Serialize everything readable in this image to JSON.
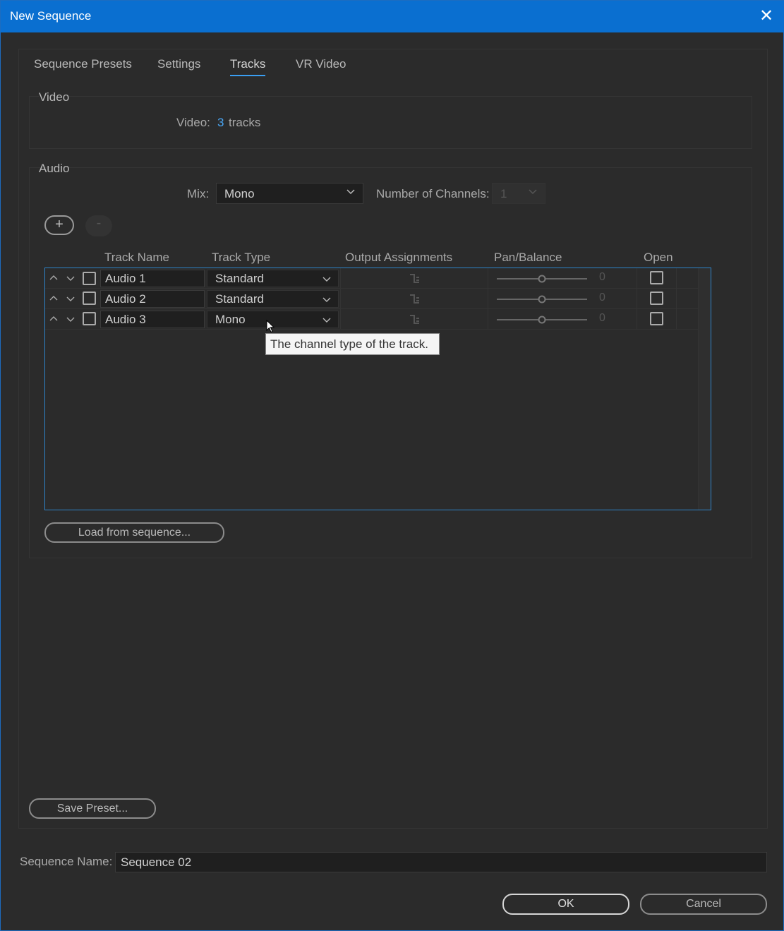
{
  "window": {
    "title": "New Sequence",
    "close_icon": "close-icon"
  },
  "tabs": [
    {
      "label": "Sequence Presets",
      "active": false
    },
    {
      "label": "Settings",
      "active": false
    },
    {
      "label": "Tracks",
      "active": true
    },
    {
      "label": "VR Video",
      "active": false
    }
  ],
  "video": {
    "group_label": "Video",
    "label": "Video:",
    "count": "3",
    "unit": "tracks"
  },
  "audio": {
    "group_label": "Audio",
    "mix_label": "Mix:",
    "mix_value": "Mono",
    "channels_label": "Number of Channels:",
    "channels_value": "1",
    "add_label": "+",
    "remove_label": "-",
    "columns": [
      "Track Name",
      "Track Type",
      "Output Assignments",
      "Pan/Balance",
      "Open"
    ],
    "tracks": [
      {
        "name": "Audio 1",
        "type": "Standard",
        "pan": "0",
        "checked": false,
        "open": false
      },
      {
        "name": "Audio 2",
        "type": "Standard",
        "pan": "0",
        "checked": false,
        "open": false
      },
      {
        "name": "Audio 3",
        "type": "Mono",
        "pan": "0",
        "checked": false,
        "open": false
      }
    ],
    "load_button": "Load from sequence..."
  },
  "tooltip": "The channel type of the track.",
  "save_preset_button": "Save Preset...",
  "sequence_name_label": "Sequence Name:",
  "sequence_name_value": "Sequence 02",
  "ok_button": "OK",
  "cancel_button": "Cancel",
  "colors": {
    "titlebar": "#0a6fd0",
    "accent": "#3a9ef2",
    "background": "#2b2b2b"
  }
}
